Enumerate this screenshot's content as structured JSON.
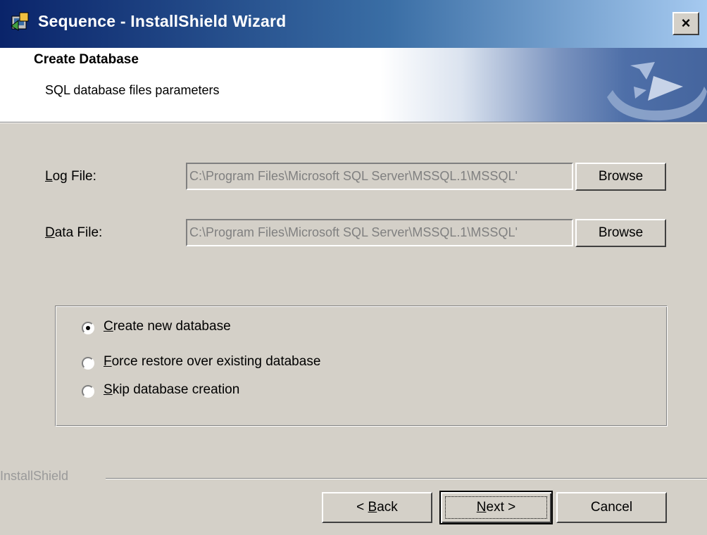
{
  "window": {
    "title": "Sequence - InstallShield Wizard",
    "close_symbol": "×"
  },
  "banner": {
    "title": "Create Database",
    "subtitle": "SQL database files parameters"
  },
  "form": {
    "log_file": {
      "label_accel": "L",
      "label_rest": "og File:",
      "value": "C:\\Program Files\\Microsoft SQL Server\\MSSQL.1\\MSSQL'",
      "browse_label": "Browse"
    },
    "data_file": {
      "label_accel": "D",
      "label_rest": "ata File:",
      "value": "C:\\Program Files\\Microsoft SQL Server\\MSSQL.1\\MSSQL'",
      "browse_label": "Browse"
    }
  },
  "options": {
    "selected": "create",
    "items": [
      {
        "id": "create",
        "accel": "C",
        "rest": "reate new database"
      },
      {
        "id": "force",
        "accel": "F",
        "rest": "orce restore over existing database"
      },
      {
        "id": "skip",
        "accel": "S",
        "rest": "kip database creation"
      }
    ]
  },
  "footer": {
    "brand": "InstallShield",
    "back_prefix": "< ",
    "back_accel": "B",
    "back_rest": "ack",
    "next_accel": "N",
    "next_rest": "ext >",
    "cancel_label": "Cancel"
  }
}
